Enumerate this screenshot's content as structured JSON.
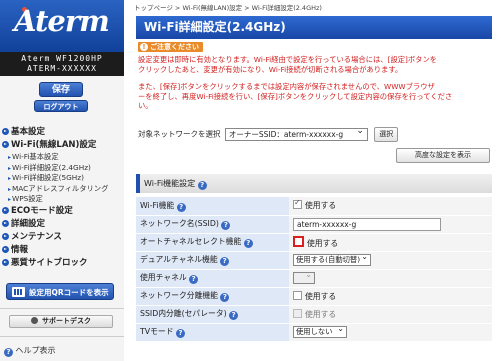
{
  "sidebar": {
    "logo": "Aterm",
    "model_line1": "Aterm WF1200HP",
    "model_line2": "ATERM-XXXXXX",
    "save_label": "保存",
    "logout_label": "ログアウト",
    "nav": [
      {
        "label": "基本設定"
      },
      {
        "label": "Wi-Fi(無線LAN)設定",
        "children": [
          "Wi-Fi基本設定",
          "Wi-Fi詳細設定(2.4GHz)",
          "Wi-Fi詳細設定(5GHz)",
          "MACアドレスフィルタリング",
          "WPS設定"
        ]
      },
      {
        "label": "ECOモード設定"
      },
      {
        "label": "詳細設定"
      },
      {
        "label": "メンテナンス"
      },
      {
        "label": "情報"
      },
      {
        "label": "悪質サイトブロック"
      }
    ],
    "qr_button": "設定用QRコードを表示",
    "support_button": "サポートデスク",
    "help_link": "ヘルプ表示"
  },
  "main": {
    "breadcrumb": "トップページ > Wi-Fi(無線LAN)設定 > Wi-Fi詳細設定(2.4GHz)",
    "title": "Wi-Fi詳細設定(2.4GHz)",
    "notice_label": "ご注意ください",
    "notice_1_line1": "設定変更は即時に有効となります。Wi-Fi経由で設定を行っている場合には、[設定]ボタンを",
    "notice_1_line2": "クリックしたあと、変更が有効になり、Wi-Fi接続が切断される場合があります。",
    "notice_2_line1": "また、[保存]ボタンをクリックするまでは設定内容が保存されませんので、WWWブラウザ",
    "notice_2_line2": "ーを終了し、再度Wi-Fi接続を行い、[保存]ボタンをクリックして設定内容の保存を行ってくださ",
    "notice_2_line3": "い。",
    "network_label": "対象ネットワークを選択",
    "network_value": "オーナーSSID：aterm-xxxxxx-g",
    "select_button": "選択",
    "advanced_button": "高度な設定を表示",
    "section_title": "Wi-Fi機能設定",
    "rows": {
      "wifi_function": {
        "label": "Wi-Fi機能",
        "value": "使用する",
        "checked": true
      },
      "network_name": {
        "label": "ネットワーク名(SSID)",
        "value": "aterm-xxxxxx-g"
      },
      "auto_channel": {
        "label": "オートチャネルセレクト機能",
        "value": "使用する",
        "checked": false
      },
      "dual_channel": {
        "label": "デュアルチャネル機能",
        "value": "使用する(自動切替)"
      },
      "channel": {
        "label": "使用チャネル",
        "value": ""
      },
      "network_separation": {
        "label": "ネットワーク分離機能",
        "value": "使用する",
        "checked": false
      },
      "ssid_separation": {
        "label": "SSID内分離(セパレータ)",
        "value": "使用する",
        "checked": false
      },
      "tv_mode": {
        "label": "TVモード",
        "value": "使用しない"
      }
    },
    "help_glyph": "?"
  },
  "colors": {
    "brand_blue": "#1d55b8",
    "notice_red": "#d32020",
    "notice_orange": "#e98b2a",
    "label_cell_bg": "#dfe8f6"
  }
}
